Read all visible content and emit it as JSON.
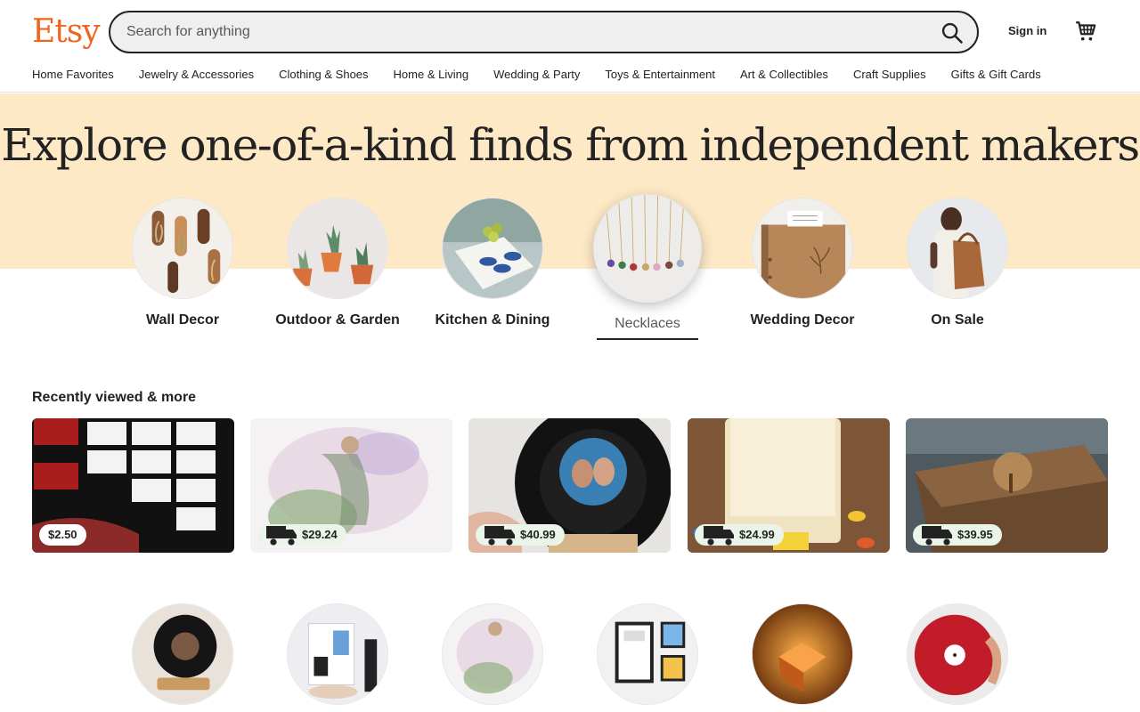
{
  "header": {
    "logo": "Etsy",
    "search_placeholder": "Search for anything",
    "signin": "Sign in",
    "icons": {
      "search": "search-icon",
      "cart": "cart-icon"
    }
  },
  "nav": [
    "Home Favorites",
    "Jewelry & Accessories",
    "Clothing & Shoes",
    "Home & Living",
    "Wedding & Party",
    "Toys & Entertainment",
    "Art & Collectibles",
    "Craft Supplies",
    "Gifts & Gift Cards"
  ],
  "hero": {
    "title": "Explore one-of-a-kind finds from independent makers",
    "categories": [
      {
        "label": "Wall Decor"
      },
      {
        "label": "Outdoor & Garden"
      },
      {
        "label": "Kitchen & Dining"
      },
      {
        "label": "Necklaces",
        "active": true
      },
      {
        "label": "Wedding Decor"
      },
      {
        "label": "On Sale"
      }
    ]
  },
  "recent": {
    "title": "Recently viewed & more",
    "items": [
      {
        "price": "$2.50",
        "free_shipping": false
      },
      {
        "price": "$29.24",
        "free_shipping": true
      },
      {
        "price": "$40.99",
        "free_shipping": true
      },
      {
        "price": "$24.99",
        "free_shipping": true
      },
      {
        "price": "$39.95",
        "free_shipping": true
      }
    ]
  },
  "colors": {
    "brand": "#f1641e",
    "hero_bg": "#fde9c6",
    "shipping_badge": "#eaf4e8"
  }
}
